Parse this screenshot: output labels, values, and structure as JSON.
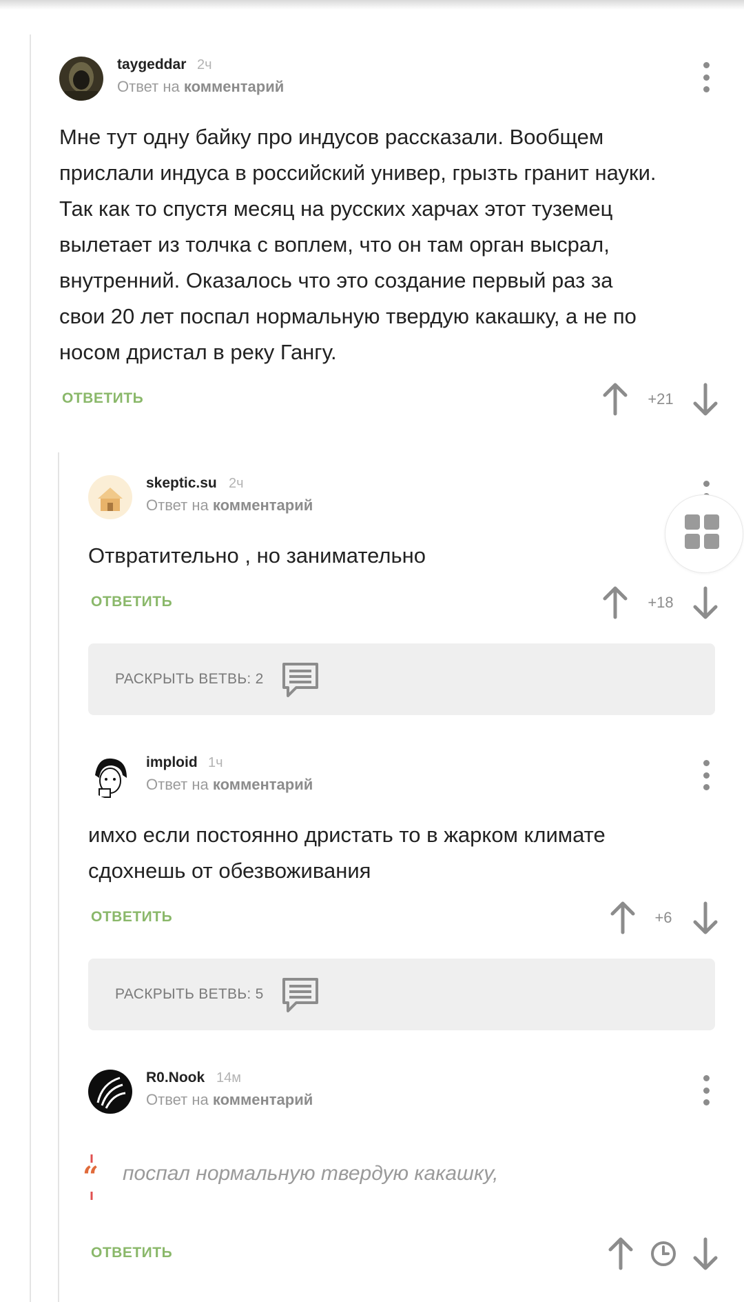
{
  "reply_prefix": "Ответ на",
  "reply_link": "комментарий",
  "reply_button": "ОТВЕТИТЬ",
  "comments": [
    {
      "author": "taygeddar",
      "time": "2ч",
      "text_lines": [
        "Мне тут одну байку про индусов рассказали. Вообщем",
        "прислали индуса в российский универ, грызть гранит науки.",
        "Так как то спустя месяц на русских харчах этот туземец",
        "вылетает из толчка с воплем, что он там орган высрал,",
        "внутренний. Оказалось что это создание первый раз за",
        "свои 20 лет поспал нормальную твердую какашку, а не по",
        "носом дристал в реку Гангу."
      ],
      "score": "+21"
    },
    {
      "author": "skeptic.su",
      "time": "2ч",
      "text_lines": [
        "Отвратительно , но занимательно"
      ],
      "score": "+18",
      "expand_label": "РАСКРЫТЬ ВЕТВЬ: 2"
    },
    {
      "author": "imploid",
      "time": "1ч",
      "text_lines": [
        "имхо если постоянно дристать то в жарком климате",
        "сдохнешь от обезвоживания"
      ],
      "score": "+6",
      "expand_label": "РАСКРЫТЬ ВЕТВЬ: 5"
    },
    {
      "author": "R0.Nook",
      "time": "14м",
      "quote": "поспал нормальную твердую какашку,"
    }
  ],
  "colors": {
    "accent_green": "#8ab86a",
    "muted": "#8c8c8c",
    "panel": "#efefef"
  },
  "icons": [
    "more-vert-icon",
    "arrow-up-icon",
    "arrow-down-icon",
    "comments-icon",
    "clock-icon",
    "quote-icon",
    "grid-icon"
  ]
}
